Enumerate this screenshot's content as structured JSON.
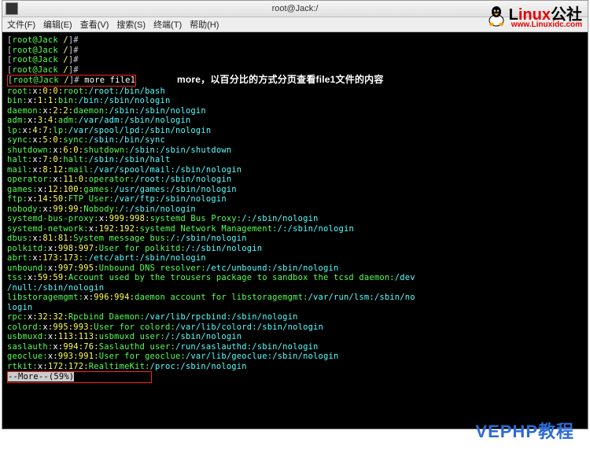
{
  "title": "root@Jack:/",
  "menu": [
    "文件(F)",
    "编辑(E)",
    "查看(V)",
    "搜索(S)",
    "终端(T)",
    "帮助(H)"
  ],
  "prompt": {
    "user_host": "root@Jack",
    "path": "/",
    "sep": "]#",
    "cmd": "more file1"
  },
  "annotation": "more，以百分比的方式分页查看file1文件的内容",
  "lines": [
    [
      "root:",
      "x:",
      "0:",
      "0:",
      "root:",
      "/root:",
      "/bin/bash"
    ],
    [
      "bin:",
      "x:",
      "1:",
      "1:",
      "bin:",
      "/bin:",
      "/sbin/nologin"
    ],
    [
      "daemon:",
      "x:",
      "2:",
      "2:",
      "daemon:",
      "/sbin:",
      "/sbin/nologin"
    ],
    [
      "adm:",
      "x:",
      "3:",
      "4:",
      "adm:",
      "/var/adm:",
      "/sbin/nologin"
    ],
    [
      "lp:",
      "x:",
      "4:",
      "7:",
      "lp:",
      "/var/spool/lpd:",
      "/sbin/nologin"
    ],
    [
      "sync:",
      "x:",
      "5:",
      "0:",
      "sync:",
      "/sbin:",
      "/bin/sync"
    ],
    [
      "shutdown:",
      "x:",
      "6:",
      "0:",
      "shutdown:",
      "/sbin:",
      "/sbin/shutdown"
    ],
    [
      "halt:",
      "x:",
      "7:",
      "0:",
      "halt:",
      "/sbin:",
      "/sbin/halt"
    ],
    [
      "mail:",
      "x:",
      "8:",
      "12:",
      "mail:",
      "/var/spool/mail:",
      "/sbin/nologin"
    ],
    [
      "operator:",
      "x:",
      "11:",
      "0:",
      "operator:",
      "/root:",
      "/sbin/nologin"
    ],
    [
      "games:",
      "x:",
      "12:",
      "100:",
      "games:",
      "/usr/games:",
      "/sbin/nologin"
    ],
    [
      "ftp:",
      "x:",
      "14:",
      "50:",
      "FTP User:",
      "/var/ftp:",
      "/sbin/nologin"
    ],
    [
      "nobody:",
      "x:",
      "99:",
      "99:",
      "Nobody:",
      "/:",
      "/sbin/nologin"
    ],
    [
      "systemd-bus-proxy:",
      "x:",
      "999:",
      "998:",
      "systemd Bus Proxy:",
      "/:",
      "/sbin/nologin"
    ],
    [
      "systemd-network:",
      "x:",
      "192:",
      "192:",
      "systemd Network Management:",
      "/:",
      "/sbin/nologin"
    ],
    [
      "dbus:",
      "x:",
      "81:",
      "81:",
      "System message bus:",
      "/:",
      "/sbin/nologin"
    ],
    [
      "polkitd:",
      "x:",
      "998:",
      "997:",
      "User for polkitd:",
      "/:",
      "/sbin/nologin"
    ],
    [
      "abrt:",
      "x:",
      "173:",
      "173:",
      ":",
      "/etc/abrt:",
      "/sbin/nologin"
    ],
    [
      "unbound:",
      "x:",
      "997:",
      "995:",
      "Unbound DNS resolver:",
      "/etc/unbound:",
      "/sbin/nologin"
    ]
  ],
  "tss_line": {
    "user": "tss:",
    "x": "x:",
    "uid": "59:",
    "gid": "59:",
    "gecos": "Account used by the trousers package to sandbox the tcsd daemon:",
    "home": "/dev/null:",
    "shell": "/sbin/nologin"
  },
  "libstorage_line": {
    "user": "libstoragemgmt:",
    "x": "x:",
    "uid": "996:",
    "gid": "994:",
    "gecos": "daemon account for libstoragemgmt:",
    "home": "/var/run/lsm:",
    "shell": "/sbin/nologin"
  },
  "lines2": [
    [
      "rpc:",
      "x:",
      "32:",
      "32:",
      "Rpcbind Daemon:",
      "/var/lib/rpcbind:",
      "/sbin/nologin"
    ],
    [
      "colord:",
      "x:",
      "995:",
      "993:",
      "User for colord:",
      "/var/lib/colord:",
      "/sbin/nologin"
    ],
    [
      "usbmuxd:",
      "x:",
      "113:",
      "113:",
      "usbmuxd user:",
      "/:",
      "/sbin/nologin"
    ],
    [
      "saslauth:",
      "x:",
      "994:",
      "76:",
      "Saslauthd user:",
      "/run/saslauthd:",
      "/sbin/nologin"
    ],
    [
      "geoclue:",
      "x:",
      "993:",
      "991:",
      "User for geoclue:",
      "/var/lib/geoclue:",
      "/sbin/nologin"
    ],
    [
      "rtkit:",
      "x:",
      "172:",
      "172:",
      "RealtimeKit:",
      "/proc:",
      "/sbin/nologin"
    ]
  ],
  "more_status": "--More--(59%)",
  "logo": {
    "l": "L",
    "inux": "inux",
    "gongshe": "公社",
    "url": "www.Linuxidc.com"
  },
  "watermark": "VEPHP教程"
}
